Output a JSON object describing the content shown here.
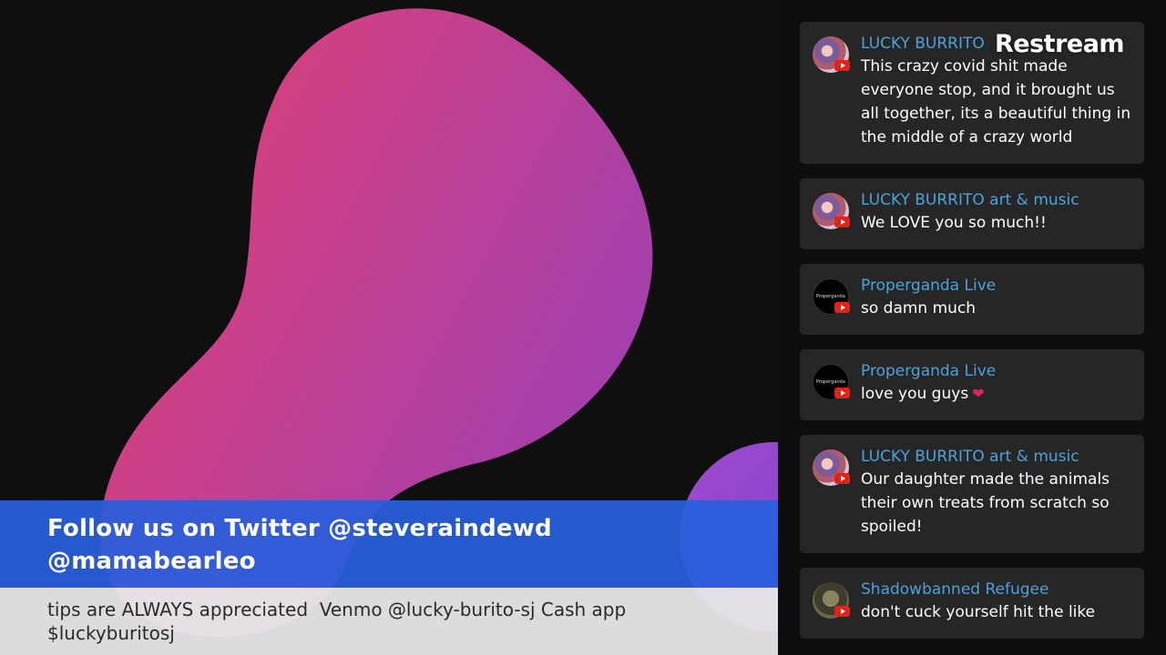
{
  "brand": {
    "label": "Restream"
  },
  "colors": {
    "username": "#4aa3d9",
    "message_bg": "#262627",
    "banner_bg": "#285fdc",
    "ticker_bg": "#e8e8e8",
    "youtube_red": "#e62117"
  },
  "banner": {
    "line1": "Follow us on Twitter @steveraindewd",
    "line2": "@mamabearleo"
  },
  "ticker": {
    "text": "tips are ALWAYS appreciated  Venmo @lucky-burito-sj Cash app $luckyburitosj"
  },
  "chat": {
    "messages": [
      {
        "author": "LUCKY BURRITO",
        "text": "This crazy covid shit made everyone stop, and it brought us all together, its a beautiful thing in the middle of a crazy world",
        "icon": "youtube-icon"
      },
      {
        "author": "LUCKY BURRITO art & music",
        "text": "We LOVE you so much!!",
        "icon": "youtube-icon"
      },
      {
        "author": "Properganda Live",
        "text": "so damn much",
        "icon": "youtube-icon"
      },
      {
        "author": "Properganda Live",
        "text": "love you guys",
        "emoji": "❤",
        "icon": "youtube-icon"
      },
      {
        "author": "LUCKY BURRITO art & music",
        "text": "Our daughter made the animals their own treats from scratch so spoiled!",
        "icon": "youtube-icon"
      },
      {
        "author": "Shadowbanned Refugee",
        "text": "don't cuck yourself hit the like",
        "icon": "youtube-icon"
      }
    ]
  }
}
